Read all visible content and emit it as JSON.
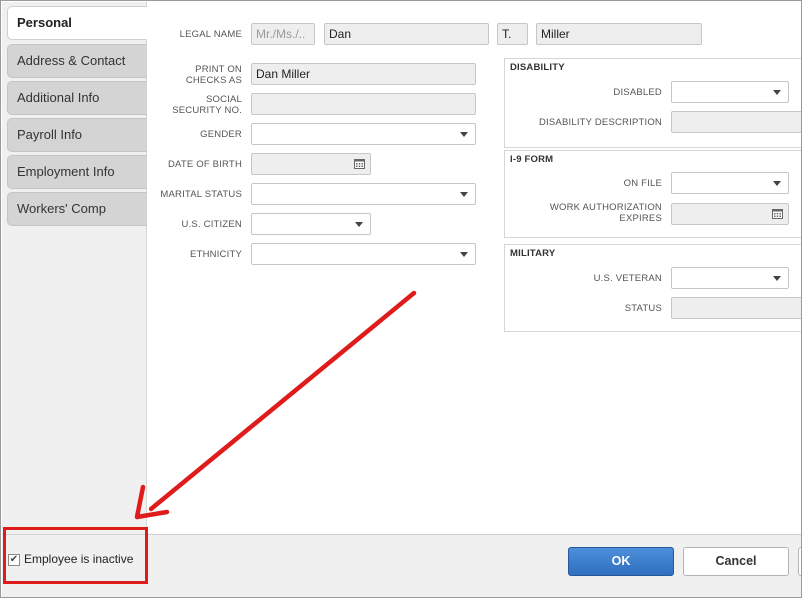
{
  "tabs": [
    {
      "label": "Personal",
      "active": true
    },
    {
      "label": "Address & Contact",
      "active": false
    },
    {
      "label": "Additional Info",
      "active": false
    },
    {
      "label": "Payroll Info",
      "active": false
    },
    {
      "label": "Employment Info",
      "active": false
    },
    {
      "label": "Workers' Comp",
      "active": false
    }
  ],
  "personal": {
    "legal_name_label": "LEGAL NAME",
    "title_placeholder": "Mr./Ms./..",
    "first_name": "Dan",
    "middle_initial": "T.",
    "last_name": "Miller",
    "print_on_checks_label_1": "PRINT ON",
    "print_on_checks_label_2": "CHECKS AS",
    "print_on_checks_value": "Dan Miller",
    "ssn_label_1": "SOCIAL",
    "ssn_label_2": "SECURITY NO.",
    "ssn_value": "",
    "gender_label": "GENDER",
    "dob_label": "DATE OF BIRTH",
    "marital_label": "MARITAL STATUS",
    "citizen_label": "U.S. CITIZEN",
    "ethnicity_label": "ETHNICITY"
  },
  "disability": {
    "header": "DISABILITY",
    "disabled_label": "DISABLED",
    "description_label": "DISABILITY DESCRIPTION"
  },
  "i9": {
    "header": "I-9 FORM",
    "on_file_label": "ON FILE",
    "work_auth_label_1": "WORK AUTHORIZATION",
    "work_auth_label_2": "EXPIRES"
  },
  "military": {
    "header": "MILITARY",
    "veteran_label": "U.S. VETERAN",
    "status_label": "STATUS"
  },
  "footer": {
    "inactive_checked": true,
    "inactive_label": "Employee is inactive",
    "ok_label": "OK",
    "cancel_label": "Cancel"
  },
  "colors": {
    "annotation": "#e01b1b",
    "ok_button": "#3a7bd0"
  },
  "icons": {
    "dropdown": "chevron-down-icon",
    "date": "calendar-icon",
    "check": "checkmark-icon"
  }
}
